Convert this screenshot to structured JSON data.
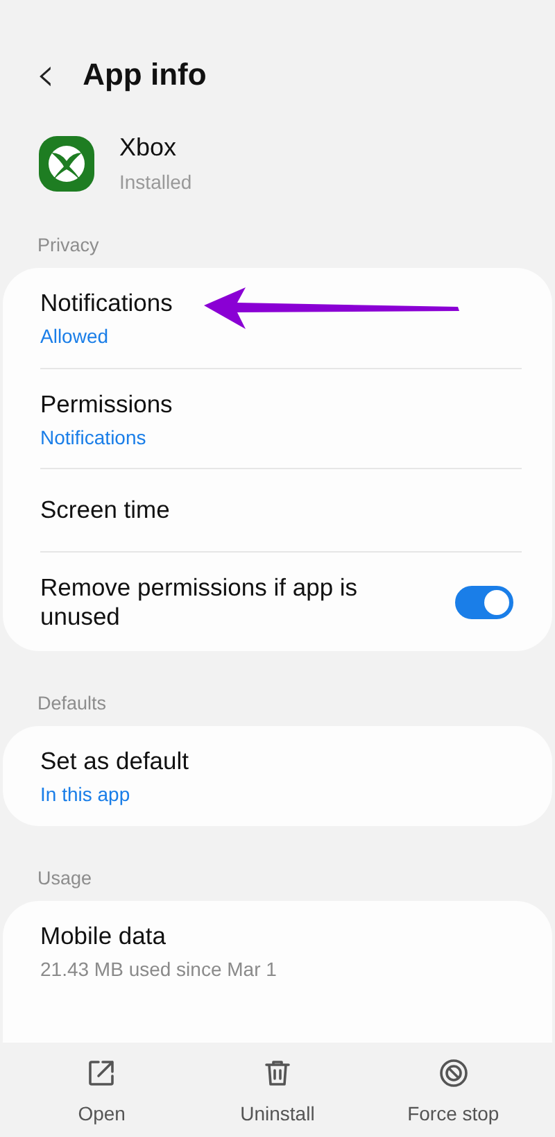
{
  "header": {
    "back": "‹",
    "title": "App info"
  },
  "app": {
    "name": "Xbox",
    "status": "Installed"
  },
  "sections": [
    {
      "title": "Privacy",
      "rows": [
        {
          "kind": "nav",
          "title": "Notifications",
          "subtitle": "Allowed",
          "subtitle_accent": true,
          "annotated": true
        },
        {
          "kind": "nav",
          "title": "Permissions",
          "subtitle": "Notifications",
          "subtitle_accent": true,
          "annotated": false
        },
        {
          "kind": "nav",
          "title": "Screen time",
          "annotated": false
        },
        {
          "kind": "toggle",
          "title": "Remove permissions if app is unused",
          "on": true,
          "annotated": false
        }
      ],
      "continues": false
    },
    {
      "title": "Defaults",
      "rows": [
        {
          "kind": "nav",
          "title": "Set as default",
          "subtitle": "In this app",
          "subtitle_accent": true,
          "annotated": false
        }
      ],
      "continues": false
    },
    {
      "title": "Usage",
      "rows": [
        {
          "kind": "nav",
          "title": "Mobile data",
          "subtitle": "21.43 MB used since Mar 1",
          "subtitle_accent": false,
          "annotated": false
        }
      ],
      "continues": true
    }
  ],
  "actions": [
    {
      "kind": "open",
      "label": "Open"
    },
    {
      "kind": "uninstall",
      "label": "Uninstall"
    },
    {
      "kind": "stop",
      "label": "Force stop"
    }
  ]
}
